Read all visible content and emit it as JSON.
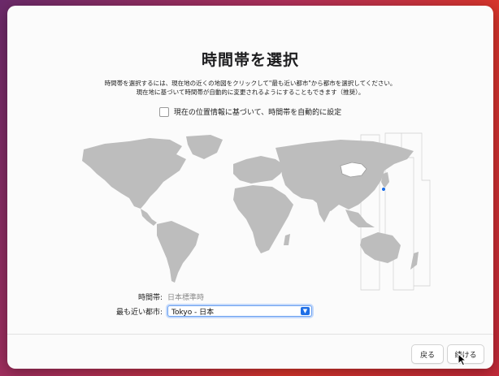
{
  "window": {
    "title": "時間帯を選択",
    "description_line1": "時間帯を選択するには、現在地の近くの地図をクリックして\"最も近い都市\"から都市を選択してください。",
    "description_line2": "現在地に基づいて時間帯が自動的に変更されるようにすることもできます（推奨）。",
    "auto_checkbox_label": "現在の位置情報に基づいて、時間帯を自動的に設定",
    "auto_checkbox_checked": false
  },
  "form": {
    "timezone_label": "時間帯:",
    "timezone_value": "日本標準時",
    "city_label": "最も近い都市:",
    "city_value": "Tokyo - 日本"
  },
  "footer": {
    "back_label": "戻る",
    "continue_label": "続ける"
  },
  "colors": {
    "accent": "#1f6fe6",
    "map_land": "#bdbdbd",
    "selected_region": "#ffffff"
  }
}
